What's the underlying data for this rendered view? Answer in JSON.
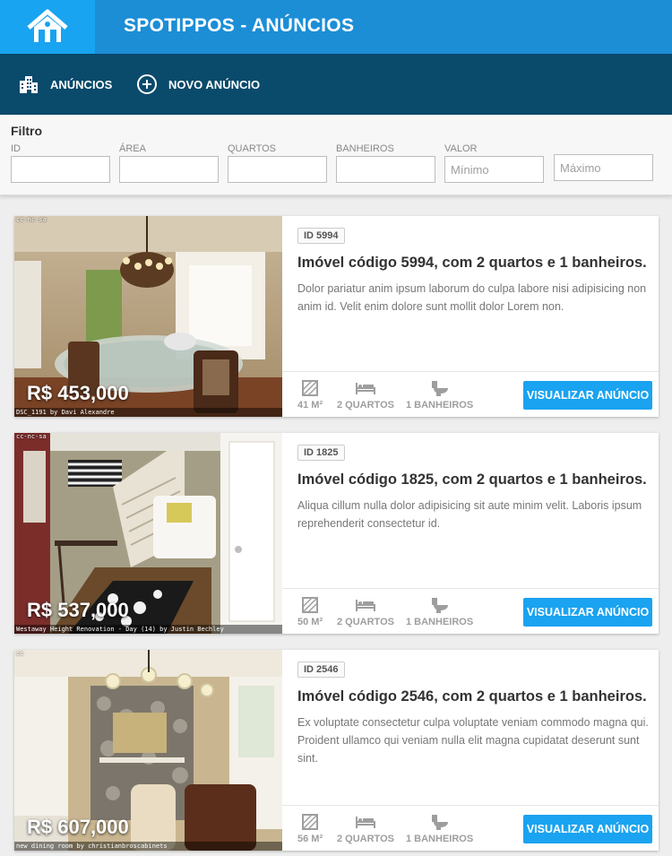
{
  "app": {
    "title": "SPOTIPPOS - ANÚNCIOS"
  },
  "nav": {
    "listings_label": "ANÚNCIOS",
    "new_listing_label": "NOVO ANÚNCIO"
  },
  "filter": {
    "title": "Filtro",
    "id_label": "ID",
    "area_label": "ÁREA",
    "rooms_label": "QUARTOS",
    "baths_label": "BANHEIROS",
    "value_label": "VALOR",
    "min_placeholder": "Mínimo",
    "max_placeholder": "Máximo"
  },
  "colors": {
    "brand": "#1c8ed6",
    "brand_light": "#18a4f0",
    "nav": "#0a4a6b",
    "button": "#1aa3f0"
  },
  "listings": [
    {
      "id_badge": "ID 5994",
      "title": "Imóvel código 5994, com 2 quartos e 1 banheiros.",
      "description": "Dolor pariatur anim ipsum laborum do culpa labore nisi adipisicing non anim id. Velit enim dolore sunt mollit dolor Lorem non.",
      "price": "R$ 453,000",
      "area": "41 M²",
      "rooms": "2 QUARTOS",
      "baths": "1 BANHEIROS",
      "photo_license": "cc-nc-sa",
      "photo_credit": "DSC_1191 by Davi Alexandre",
      "button": "VISUALIZAR ANÚNCIO"
    },
    {
      "id_badge": "ID 1825",
      "title": "Imóvel código 1825, com 2 quartos e 1 banheiros.",
      "description": "Aliqua cillum nulla dolor adipisicing sit aute minim velit. Laboris ipsum reprehenderit consectetur id.",
      "price": "R$ 537,000",
      "area": "50 M²",
      "rooms": "2 QUARTOS",
      "baths": "1 BANHEIROS",
      "photo_license": "cc-nc-sa",
      "photo_credit": "Westaway Height Renovation - Day (14) by Justin Bechley",
      "button": "VISUALIZAR ANÚNCIO"
    },
    {
      "id_badge": "ID 2546",
      "title": "Imóvel código 2546, com 2 quartos e 1 banheiros.",
      "description": "Ex voluptate consectetur culpa voluptate veniam commodo magna qui. Proident ullamco qui veniam nulla elit magna cupidatat deserunt sunt sint.",
      "price": "R$ 607,000",
      "area": "56 M²",
      "rooms": "2 QUARTOS",
      "baths": "1 BANHEIROS",
      "photo_license": "cc",
      "photo_credit": "new dining room by christianbroscabinets",
      "button": "VISUALIZAR ANÚNCIO"
    }
  ]
}
